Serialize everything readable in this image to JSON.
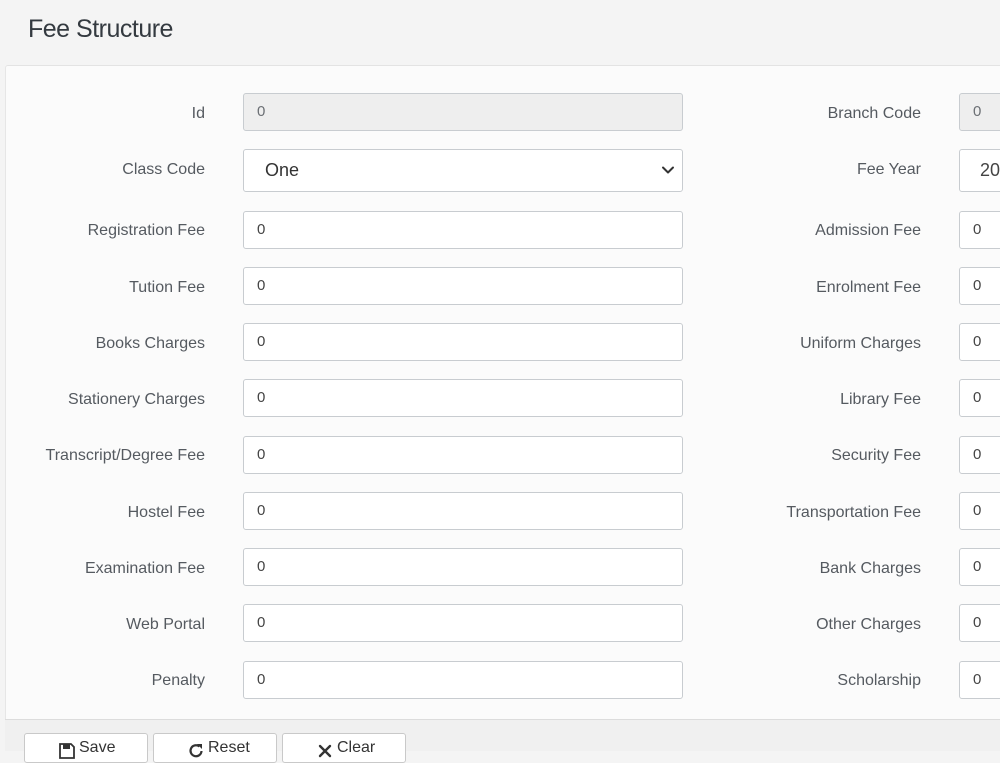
{
  "page": {
    "title": "Fee Structure"
  },
  "form": {
    "id": {
      "label": "Id",
      "value": "0"
    },
    "branch_code": {
      "label": "Branch Code",
      "value": "0"
    },
    "class_code": {
      "label": "Class Code",
      "value": "One"
    },
    "fee_year": {
      "label": "Fee Year",
      "value": "20"
    },
    "left_fields": [
      {
        "label": "Registration Fee",
        "value": "0"
      },
      {
        "label": "Tution Fee",
        "value": "0"
      },
      {
        "label": "Books Charges",
        "value": "0"
      },
      {
        "label": "Stationery Charges",
        "value": "0"
      },
      {
        "label": "Transcript/Degree Fee",
        "value": "0"
      },
      {
        "label": "Hostel Fee",
        "value": "0"
      },
      {
        "label": "Examination Fee",
        "value": "0"
      },
      {
        "label": "Web Portal",
        "value": "0"
      },
      {
        "label": "Penalty",
        "value": "0"
      }
    ],
    "right_fields": [
      {
        "label": "Admission Fee",
        "value": "0"
      },
      {
        "label": "Enrolment Fee",
        "value": "0"
      },
      {
        "label": "Uniform Charges",
        "value": "0"
      },
      {
        "label": "Library Fee",
        "value": "0"
      },
      {
        "label": "Security Fee",
        "value": "0"
      },
      {
        "label": "Transportation Fee",
        "value": "0"
      },
      {
        "label": "Bank Charges",
        "value": "0"
      },
      {
        "label": "Other Charges",
        "value": "0"
      },
      {
        "label": "Scholarship",
        "value": "0"
      }
    ]
  },
  "buttons": {
    "save": {
      "label": "Save",
      "icon": "floppy-disk-icon"
    },
    "reset": {
      "label": "Reset",
      "icon": "refresh-icon"
    },
    "clear": {
      "label": "Clear",
      "icon": "close-icon"
    }
  }
}
